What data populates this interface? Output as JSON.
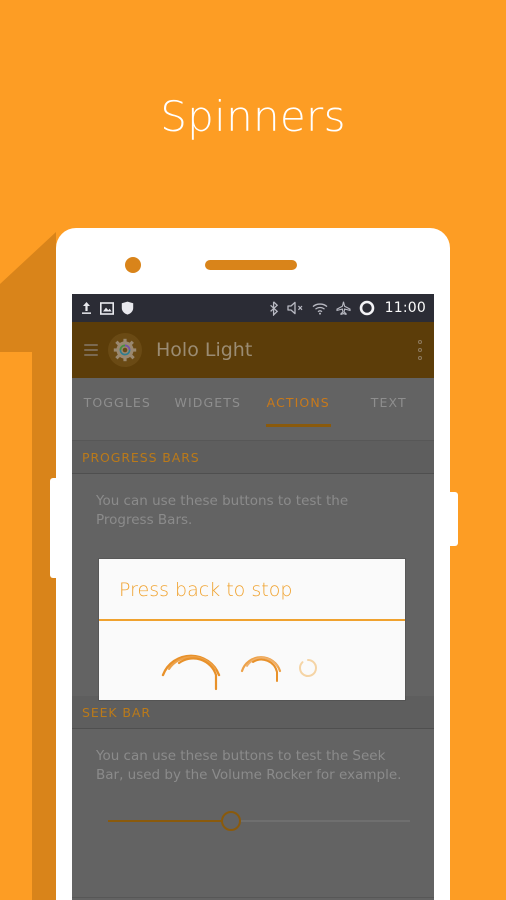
{
  "hero": {
    "title": "Spinners"
  },
  "colors": {
    "background_orange": "#fd9d24",
    "shadow_orange": "#d9841a",
    "action_bar": "#5c3d09",
    "screen_dim": "#636363",
    "status_bar": "#2b2c35",
    "accent_orange": "#bb7a19",
    "dialog_accent": "#f0a22e",
    "phone_body": "#ffffff"
  },
  "status_bar": {
    "left_icons": [
      "upload-icon",
      "image-icon",
      "shield-icon"
    ],
    "right_icons": [
      "bluetooth-icon",
      "volume-muted-icon",
      "wifi-icon",
      "airplane-mode-icon",
      "ring-icon"
    ],
    "time": "11:00"
  },
  "action_bar": {
    "menu_icon": "hamburger-menu-icon",
    "app_icon": "gear-icon",
    "title": "Holo Light",
    "overflow_icon": "overflow-menu-icon"
  },
  "tabs": [
    {
      "label": "TOGGLES",
      "active": false
    },
    {
      "label": "WIDGETS",
      "active": false
    },
    {
      "label": "ACTIONS",
      "active": true
    },
    {
      "label": "TEXT",
      "active": false
    }
  ],
  "sections": [
    {
      "header": "PROGRESS BARS",
      "description": "You can use these buttons to test the Progress Bars."
    },
    {
      "header": "SEEK BAR",
      "description": "You can use these buttons to test the Seek Bar, used by the Volume Rocker for example."
    }
  ],
  "dialog": {
    "title": "Press back to stop",
    "spinners": [
      "spinner-large",
      "spinner-medium",
      "spinner-small"
    ]
  },
  "seek_bar": {
    "value_percent": 42,
    "thumb": "seek-thumb"
  },
  "phone": {
    "camera": "camera-dot",
    "speaker": "speaker-grille",
    "volume_button": "volume-rocker-button",
    "power_button": "power-button"
  }
}
